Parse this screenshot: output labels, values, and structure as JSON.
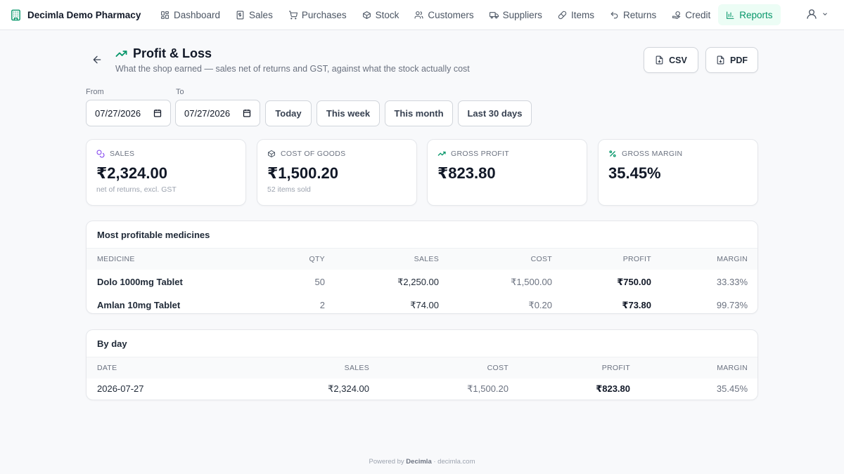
{
  "brand": {
    "name": "Decimla Demo Pharmacy"
  },
  "nav": [
    {
      "label": "Dashboard",
      "icon": "grid-icon"
    },
    {
      "label": "Sales",
      "icon": "receipt-icon"
    },
    {
      "label": "Purchases",
      "icon": "cart-icon"
    },
    {
      "label": "Stock",
      "icon": "box-icon"
    },
    {
      "label": "Customers",
      "icon": "users-icon"
    },
    {
      "label": "Suppliers",
      "icon": "truck-icon"
    },
    {
      "label": "Items",
      "icon": "pill-icon"
    },
    {
      "label": "Returns",
      "icon": "undo-icon"
    },
    {
      "label": "Credit",
      "icon": "handcoins-icon"
    },
    {
      "label": "Reports",
      "icon": "bar-chart-icon",
      "active": true
    }
  ],
  "header": {
    "title": "Profit & Loss",
    "subtitle": "What the shop earned — sales net of returns and GST, against what the stock actually cost",
    "csv_label": "CSV",
    "pdf_label": "PDF"
  },
  "filters": {
    "from_label": "From",
    "to_label": "To",
    "from_value": "07/27/2026",
    "to_value": "07/27/2026",
    "presets": [
      "Today",
      "This week",
      "This month",
      "Last 30 days"
    ]
  },
  "stats": [
    {
      "label": "SALES",
      "value": "₹2,324.00",
      "sub": "net of returns, excl. GST",
      "icon": "coins-icon"
    },
    {
      "label": "COST OF GOODS",
      "value": "₹1,500.20",
      "sub": "52 items sold",
      "icon": "package-icon"
    },
    {
      "label": "GROSS PROFIT",
      "value": "₹823.80",
      "sub": "",
      "icon": "trending-up-icon"
    },
    {
      "label": "GROSS MARGIN",
      "value": "35.45%",
      "sub": "",
      "icon": "percent-icon"
    }
  ],
  "top_medicines": {
    "title": "Most profitable medicines",
    "columns": [
      "MEDICINE",
      "QTY",
      "SALES",
      "COST",
      "PROFIT",
      "MARGIN"
    ],
    "rows": [
      [
        "Dolo 1000mg Tablet",
        "50",
        "₹2,250.00",
        "₹1,500.00",
        "₹750.00",
        "33.33%"
      ],
      [
        "Amlan 10mg Tablet",
        "2",
        "₹74.00",
        "₹0.20",
        "₹73.80",
        "99.73%"
      ]
    ]
  },
  "by_day": {
    "title": "By day",
    "columns": [
      "DATE",
      "SALES",
      "COST",
      "PROFIT",
      "MARGIN"
    ],
    "rows": [
      [
        "2026-07-27",
        "₹2,324.00",
        "₹1,500.20",
        "₹823.80",
        "35.45%"
      ]
    ]
  },
  "footer": {
    "prefix": "Powered by",
    "brand": "Decimla",
    "suffix": "· decimla.com"
  },
  "colors": {
    "accent": "#059669",
    "accent_bg": "#ecfdf5"
  }
}
